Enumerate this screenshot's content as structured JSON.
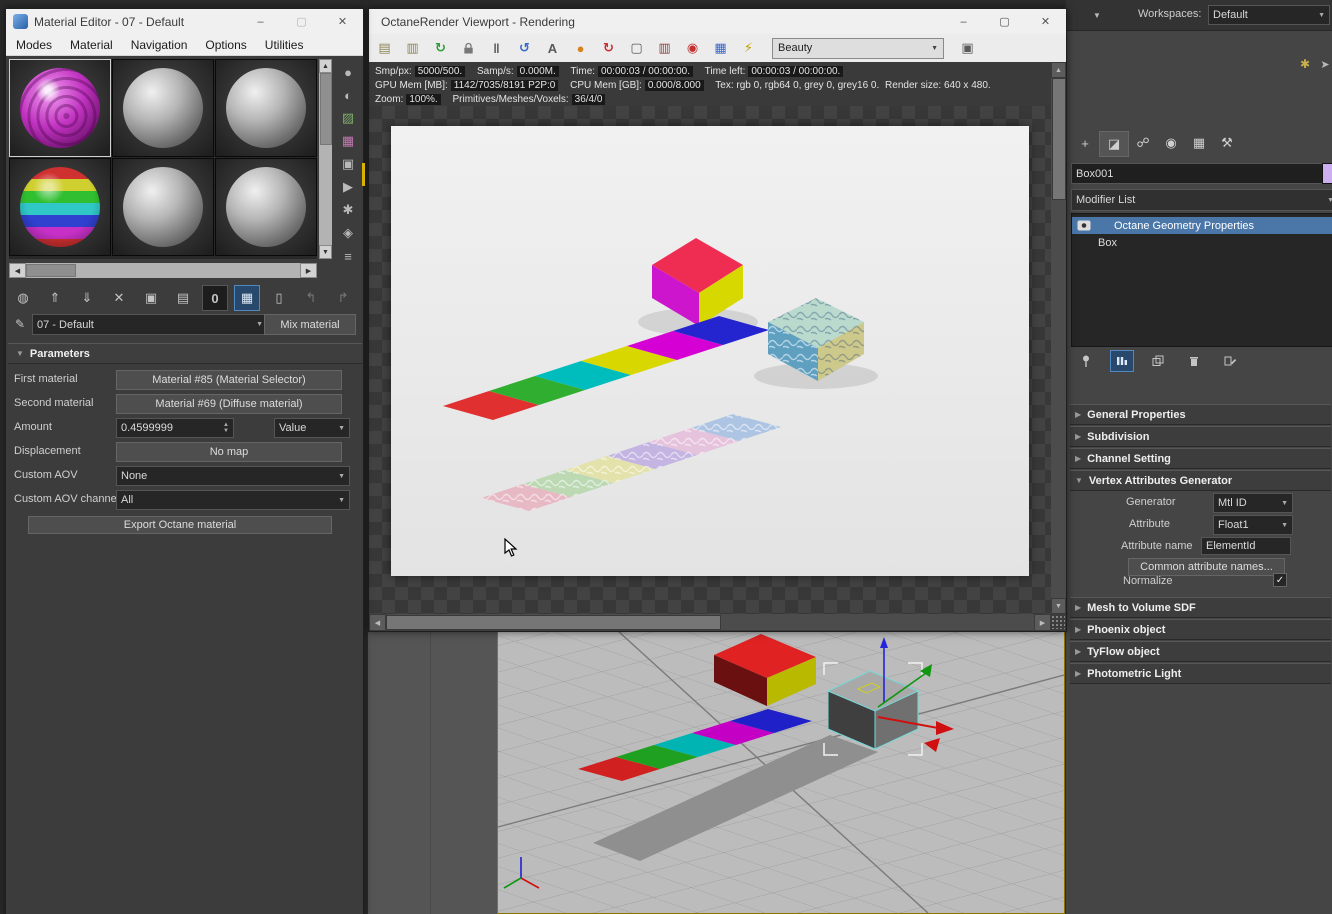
{
  "icons": {
    "dropdown": "▼",
    "spinner_up": "▲",
    "spinner_down": "▼",
    "scroll_up": "▲",
    "scroll_down": "▼",
    "scroll_left": "◀",
    "scroll_right": "▶",
    "check": "✓",
    "pencil": "✎",
    "minimize": "–",
    "maximize": "▢",
    "close": "✕",
    "rollout_collapsed": "▶",
    "rollout_expanded": "▼",
    "workspace_caret": "▼",
    "me_side": {
      "sample_type": "●",
      "backlight": "◐",
      "background": "▨",
      "uv_tiling": "▦",
      "video_check": "▣",
      "preview": "▶",
      "options": "✱",
      "select_by_material": "◈",
      "navigator": "≡"
    },
    "me_toolbar": {
      "get_material": "◍",
      "put_to_scene": "⇑",
      "assign_to_selection": "⇓",
      "reset": "✕",
      "make_copy": "▣",
      "put_to_library": "▤",
      "material_id": "0",
      "show_in_viewport": "▦",
      "show_end_result": "▯",
      "go_to_parent": "↰",
      "go_forward_sibling": "↱"
    },
    "octane_toolbar": {
      "save": "▤",
      "clipboard": "▥",
      "refresh": "↻",
      "pause": "‖",
      "restart": "↺",
      "font_overlay": "A",
      "render_passes": "●",
      "reset_render": "↻",
      "screen": "▢",
      "print": "▥",
      "camera": "◉",
      "film": "▦",
      "bolt": "⚡",
      "fullscreen": "▣"
    },
    "tabs": {
      "create": "+",
      "modify": "◪",
      "hierarchy": "☍",
      "motion": "◉",
      "display": "▦",
      "utilities": "⚒"
    },
    "main_toolbar_right": {
      "icon1": "✱",
      "icon2": "➤"
    }
  },
  "material_editor": {
    "title": "Material Editor - 07 - Default",
    "menus": [
      "Modes",
      "Material",
      "Navigation",
      "Options",
      "Utilities"
    ],
    "name_combo": "07 - Default",
    "type_button": "Mix material",
    "parameters": {
      "title": "Parameters",
      "first_material_label": "First material",
      "first_material_value": "Material #85 (Material Selector)",
      "second_material_label": "Second material",
      "second_material_value": "Material #69 (Diffuse material)",
      "amount_label": "Amount",
      "amount_value": "0.4599999",
      "amount_mode": "Value",
      "displacement_label": "Displacement",
      "displacement_value": "No map",
      "custom_aov_label": "Custom AOV",
      "custom_aov_value": "None",
      "custom_aov_channel_label": "Custom AOV channel",
      "custom_aov_channel_value": "All",
      "export_button": "Export Octane material"
    }
  },
  "octane": {
    "title": "OctaneRender Viewport - Rendering",
    "render_pass": "Beauty",
    "stats": {
      "smp_label": "Smp/px:",
      "smp_value": "5000/500.",
      "samp_label": "Samp/s:",
      "samp_value": "0.000M.",
      "time_label": "Time:",
      "time_value": "00:00:03 / 00:00:00.",
      "timeleft_label": "Time left:",
      "timeleft_value": "00:00:03 / 00:00:00.",
      "gpu_label": "GPU Mem [MB]:",
      "gpu_value": "1142/7035/8191 P2P:0",
      "cpu_label": "CPU Mem [GB]:",
      "cpu_value": "0.000/8.000",
      "tex_label": "Tex: rgb 0, rgb64 0, grey 0, grey16 0.",
      "render_size": "Render size: 640 x 480.",
      "zoom_label": "Zoom:",
      "zoom_value": "100%.",
      "prim_label": "Primitives/Meshes/Voxels:",
      "prim_value": "36/4/0"
    }
  },
  "command_panel": {
    "workspaces_label": "Workspaces:",
    "workspaces_value": "Default",
    "object_name": "Box001",
    "modifier_list": "Modifier List",
    "stack": [
      "Octane Geometry Properties",
      "Box"
    ],
    "rollouts": {
      "general_properties": "General Properties",
      "subdivision": "Subdivision",
      "channel_setting": "Channel Setting",
      "vertex_attributes": "Vertex Attributes Generator",
      "mesh_to_volume": "Mesh to Volume SDF",
      "phoenix": "Phoenix object",
      "tyflow": "TyFlow object",
      "photometric": "Photometric Light"
    },
    "vag": {
      "generator_label": "Generator",
      "generator_value": "Mtl ID",
      "attribute_label": "Attribute",
      "attribute_value": "Float1",
      "attribute_name_label": "Attribute name",
      "attribute_name_value": "ElementId",
      "common_button": "Common attribute names...",
      "normalize_label": "Normalize"
    }
  },
  "colors": {
    "stack_selection": "#4a76a8",
    "object_color_swatch": "#cdaef0",
    "viewport_active_border": "#8d7500",
    "highlight_icon": "#28496b"
  }
}
